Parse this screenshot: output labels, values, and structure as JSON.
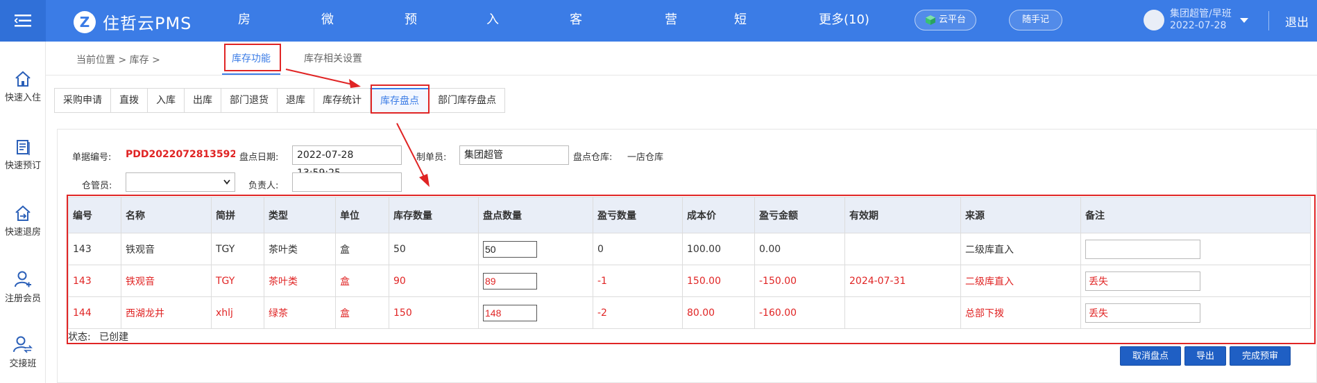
{
  "header": {
    "brand": "住哲云PMS",
    "nav": [
      "房态中心",
      "微信开门",
      "预订管理",
      "入住管理",
      "客户关系",
      "营销",
      "短信营销",
      "更多(10)"
    ],
    "cloud_platform": "云平台",
    "notes_button": "随手记",
    "user_name": "集团超管/早班",
    "user_date": "2022-07-28",
    "logout": "退出"
  },
  "sidebar": [
    {
      "label": "快速入住",
      "icon": "home-icon"
    },
    {
      "label": "快速预订",
      "icon": "clipboard-icon"
    },
    {
      "label": "快速退房",
      "icon": "checkout-icon"
    },
    {
      "label": "注册会员",
      "icon": "add-user-icon"
    },
    {
      "label": "交接班",
      "icon": "shift-exchange-icon"
    }
  ],
  "breadcrumb": "当前位置 > 库存 >",
  "section_tabs": [
    "库存功能",
    "库存相关设置"
  ],
  "tabs": [
    "采购申请",
    "直拨",
    "入库",
    "出库",
    "部门退货",
    "退库",
    "库存统计",
    "库存盘点",
    "部门库存盘点"
  ],
  "form": {
    "doc_no_label": "单据编号:",
    "doc_no": "PDD2022072813592",
    "date_label": "盘点日期:",
    "date_value": "2022-07-28 13:59:25",
    "maker_label": "制单员:",
    "maker_value": "集团超管",
    "warehouse_label": "盘点仓库:",
    "warehouse_value": "一店仓库",
    "keeper_label": "仓管员:",
    "keeper_value": "",
    "owner_label": "负责人:",
    "owner_value": ""
  },
  "table": {
    "columns": [
      "编号",
      "名称",
      "简拼",
      "类型",
      "单位",
      "库存数量",
      "盘点数量",
      "盈亏数量",
      "成本价",
      "盈亏金额",
      "有效期",
      "来源",
      "备注"
    ],
    "rows": [
      {
        "id": "143",
        "name": "铁观音",
        "abbr": "TGY",
        "type": "茶叶类",
        "unit": "盒",
        "stock": "50",
        "counted": "50",
        "diff": "0",
        "cost": "100.00",
        "amount": "0.00",
        "expiry": "",
        "source": "二级库直入",
        "remark": ""
      },
      {
        "id": "143",
        "name": "铁观音",
        "abbr": "TGY",
        "type": "茶叶类",
        "unit": "盒",
        "stock": "90",
        "counted": "89",
        "diff": "-1",
        "cost": "150.00",
        "amount": "-150.00",
        "expiry": "2024-07-31",
        "source": "二级库直入",
        "remark": "丢失"
      },
      {
        "id": "144",
        "name": "西湖龙井",
        "abbr": "xhlj",
        "type": "绿茶",
        "unit": "盒",
        "stock": "150",
        "counted": "148",
        "diff": "-2",
        "cost": "80.00",
        "amount": "-160.00",
        "expiry": "",
        "source": "总部下拨",
        "remark": "丢失"
      }
    ]
  },
  "status_label": "状态:",
  "status_value": "已创建",
  "buttons": {
    "cancel": "取消盘点",
    "export": "导出",
    "finish": "完成预审"
  },
  "colors": {
    "header_bg": "#3b7ce6",
    "accent": "#3b7ce6",
    "alert": "#e02424",
    "button": "#1f5fc4"
  }
}
